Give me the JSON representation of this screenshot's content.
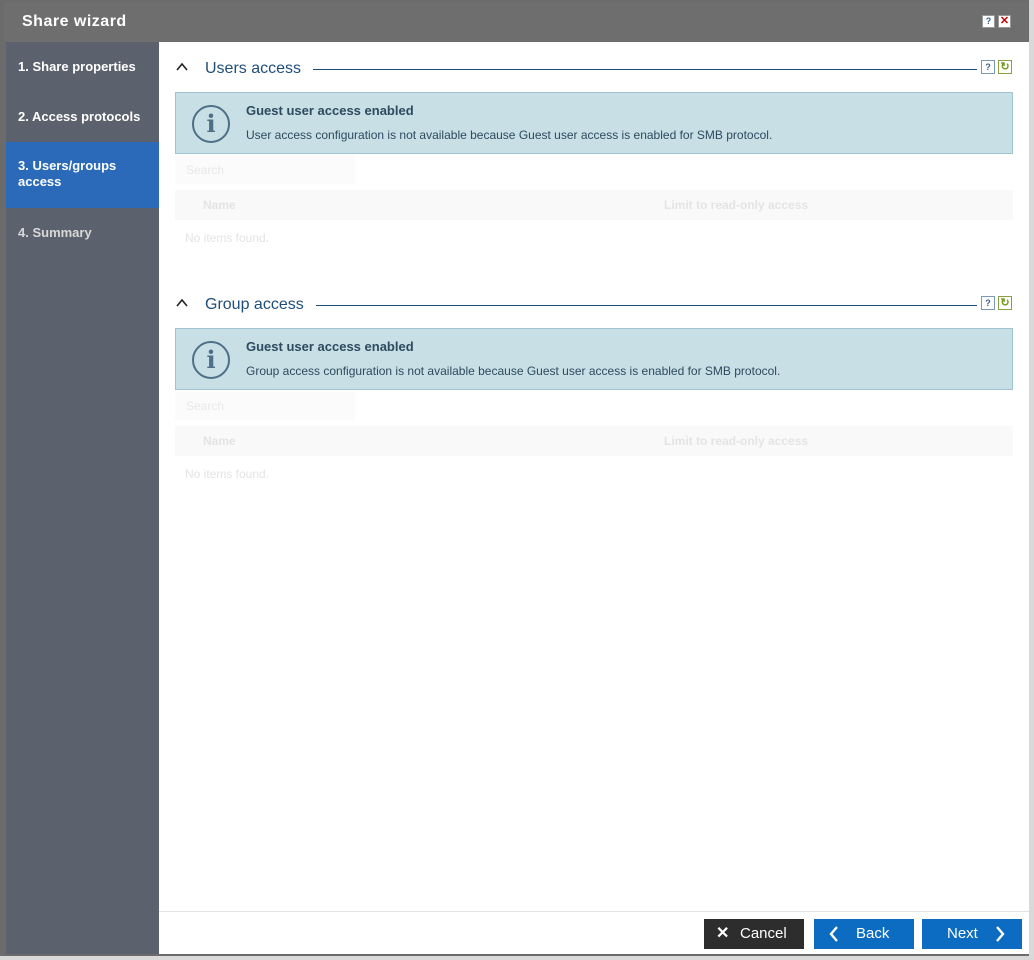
{
  "window": {
    "title": "Share wizard",
    "help_label": "?",
    "close_label": "✕"
  },
  "sidebar": {
    "items": [
      {
        "label": "1. Share properties"
      },
      {
        "label": "2. Access protocols"
      },
      {
        "label": "3. Users/groups access"
      },
      {
        "label": "4. Summary"
      }
    ],
    "active_index": 2
  },
  "users_section": {
    "title": "Users access",
    "info_title": "Guest user access enabled",
    "info_text": "User access configuration is not available because Guest user access is enabled for SMB protocol.",
    "search_placeholder": "Search",
    "columns": [
      "Name",
      "Limit to read-only access"
    ],
    "empty_text": "No items found."
  },
  "groups_section": {
    "title": "Group access",
    "info_title": "Guest user access enabled",
    "info_text": "Group access configuration is not available because Guest user access is enabled for SMB protocol.",
    "search_placeholder": "Search",
    "columns": [
      "Name",
      "Limit to read-only access"
    ],
    "empty_text": "No items found."
  },
  "footer": {
    "cancel_label": "Cancel",
    "back_label": "Back",
    "next_label": "Next"
  },
  "colors": {
    "accent": "#0b6cc2",
    "active_nav": "#2a6ab8",
    "sidebar": "#5c626d",
    "info_bg": "#c8dfe6"
  },
  "icons": {
    "info": "info-icon",
    "collapse": "chevron-up-icon",
    "help": "help-icon",
    "refresh": "refresh-icon",
    "close": "close-icon",
    "back": "chevron-left-icon",
    "next": "chevron-right-icon"
  }
}
